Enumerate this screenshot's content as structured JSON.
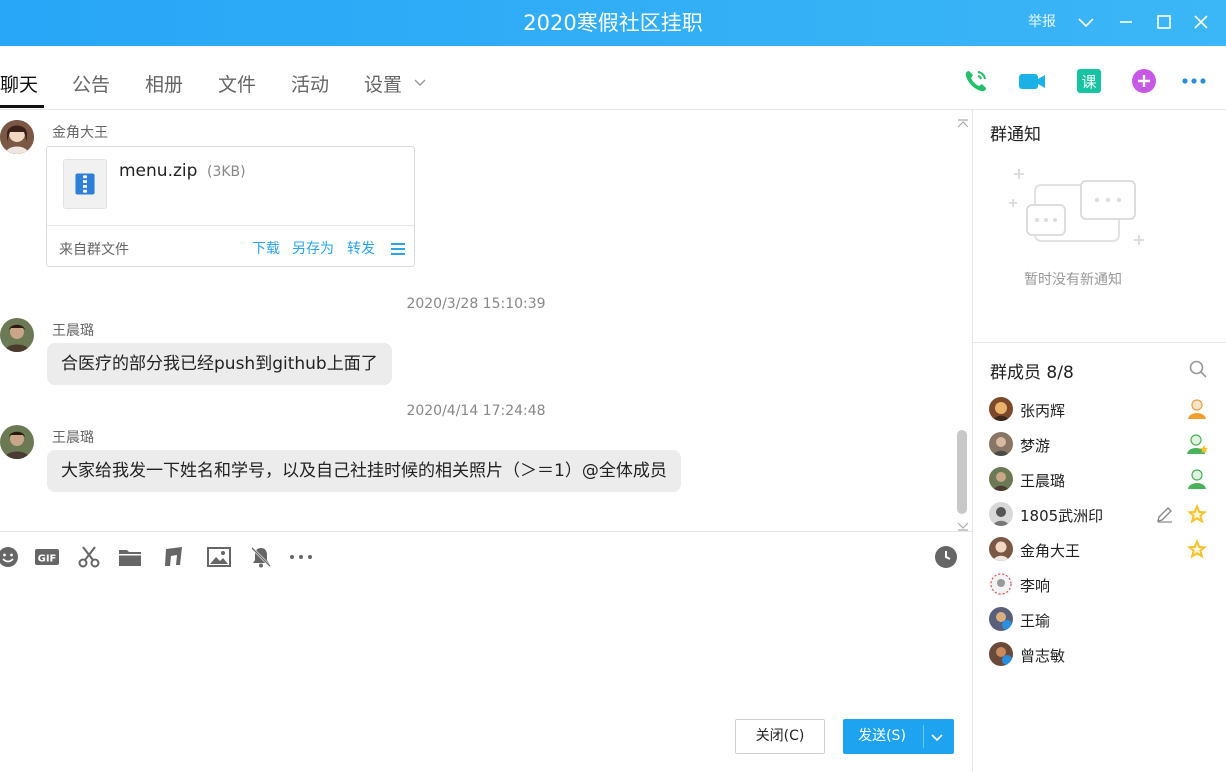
{
  "window": {
    "title": "2020寒假社区挂职",
    "report": "举报"
  },
  "tabs": [
    {
      "label": "聊天",
      "active": true
    },
    {
      "label": "公告"
    },
    {
      "label": "相册"
    },
    {
      "label": "文件"
    },
    {
      "label": "活动"
    },
    {
      "label": "设置"
    }
  ],
  "top_icons": [
    "phone-icon",
    "video-call-icon",
    "class-icon",
    "add-app-icon",
    "more-icon"
  ],
  "chat": {
    "file_message": {
      "sender": "金角大王",
      "file_name": "menu.zip",
      "file_size": "(3KB)",
      "source": "来自群文件",
      "actions": [
        "下载",
        "另存为",
        "转发"
      ]
    },
    "messages": [
      {
        "timestamp": "2020/3/28 15:10:39",
        "sender": "王晨璐",
        "text": "合医疗的部分我已经push到github上面了"
      },
      {
        "timestamp": "2020/4/14 17:24:48",
        "sender": "王晨璐",
        "text": "大家给我发一下姓名和学号，以及自己社挂时候的相关照片（＞＝1）@全体成员"
      }
    ]
  },
  "toolbar_icons": [
    "emoji-icon",
    "gif-icon",
    "screenshot-scissors-icon",
    "folder-icon",
    "music-icon",
    "image-icon",
    "mute-bell-icon",
    "more-dots-icon",
    "history-clock-icon"
  ],
  "buttons": {
    "close": "关闭(C)",
    "send": "发送(S)"
  },
  "notice": {
    "title": "群通知",
    "empty": "暂时没有新通知"
  },
  "members": {
    "title": "群成员 8/8",
    "list": [
      {
        "name": "张丙辉",
        "role": "owner"
      },
      {
        "name": "梦游",
        "role": "admin"
      },
      {
        "name": "王晨璐",
        "role": "admin"
      },
      {
        "name": "1805武洲印",
        "role": "star"
      },
      {
        "name": "金角大王",
        "role": "star"
      },
      {
        "name": "李响",
        "role": ""
      },
      {
        "name": "王瑜",
        "role": ""
      },
      {
        "name": "曾志敏",
        "role": ""
      }
    ]
  },
  "colors": {
    "accent": "#1da3f0",
    "titlebar": "#28a6f7",
    "link": "#2ba3e8"
  }
}
